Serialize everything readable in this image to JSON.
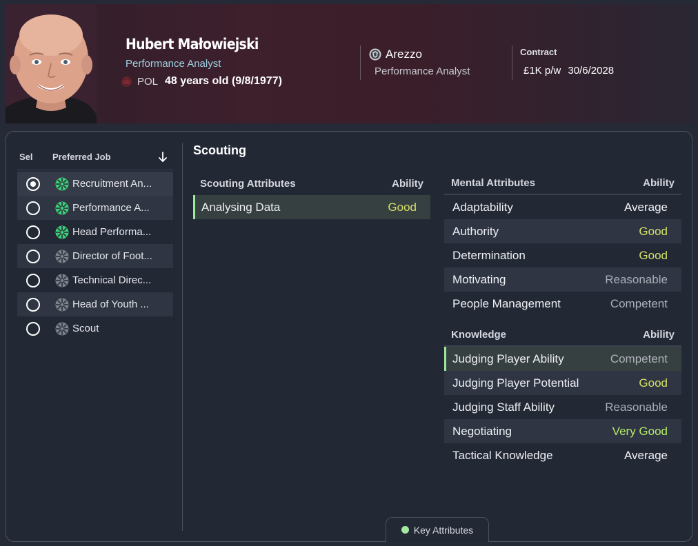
{
  "person": {
    "name": "Hubert Małowiejski",
    "role": "Performance Analyst",
    "nationality": "POL",
    "age_text": "48 years old (9/8/1977)"
  },
  "club": {
    "name": "Arezzo",
    "role": "Performance Analyst"
  },
  "contract": {
    "label": "Contract",
    "wage": "£1K p/w",
    "expiry": "30/6/2028"
  },
  "jobs_panel": {
    "col_sel": "Sel",
    "col_job": "Preferred Job",
    "items": [
      {
        "label": "Recruitment An...",
        "selected": true,
        "icon": "green-wheel-icon"
      },
      {
        "label": "Performance A...",
        "selected": false,
        "icon": "green-wheel-icon"
      },
      {
        "label": "Head Performa...",
        "selected": false,
        "icon": "green-wheel-icon"
      },
      {
        "label": "Director of Foot...",
        "selected": false,
        "icon": "grey-wheel-icon"
      },
      {
        "label": "Technical Direc...",
        "selected": false,
        "icon": "grey-wheel-icon"
      },
      {
        "label": "Head of Youth ...",
        "selected": false,
        "icon": "grey-wheel-icon"
      },
      {
        "label": "Scout",
        "selected": false,
        "icon": "grey-wheel-icon"
      }
    ]
  },
  "section_title": "Scouting",
  "scouting": {
    "header": "Scouting Attributes",
    "ability_header": "Ability",
    "rows": [
      {
        "name": "Analysing Data",
        "ability": "Good"
      }
    ]
  },
  "mental": {
    "header": "Mental Attributes",
    "ability_header": "Ability",
    "rows": [
      {
        "name": "Adaptability",
        "ability": "Average"
      },
      {
        "name": "Authority",
        "ability": "Good"
      },
      {
        "name": "Determination",
        "ability": "Good"
      },
      {
        "name": "Motivating",
        "ability": "Reasonable"
      },
      {
        "name": "People Management",
        "ability": "Competent"
      }
    ]
  },
  "knowledge": {
    "header": "Knowledge",
    "ability_header": "Ability",
    "rows": [
      {
        "name": "Judging Player Ability",
        "ability": "Competent"
      },
      {
        "name": "Judging Player Potential",
        "ability": "Good"
      },
      {
        "name": "Judging Staff Ability",
        "ability": "Reasonable"
      },
      {
        "name": "Negotiating",
        "ability": "Very Good"
      },
      {
        "name": "Tactical Knowledge",
        "ability": "Average"
      }
    ]
  },
  "legend": {
    "label": "Key Attributes",
    "color": "#a3eaa0"
  },
  "colors": {
    "key_highlight": "#9ee89a",
    "good": "#d6e069",
    "very_good": "#b7ea6c"
  }
}
